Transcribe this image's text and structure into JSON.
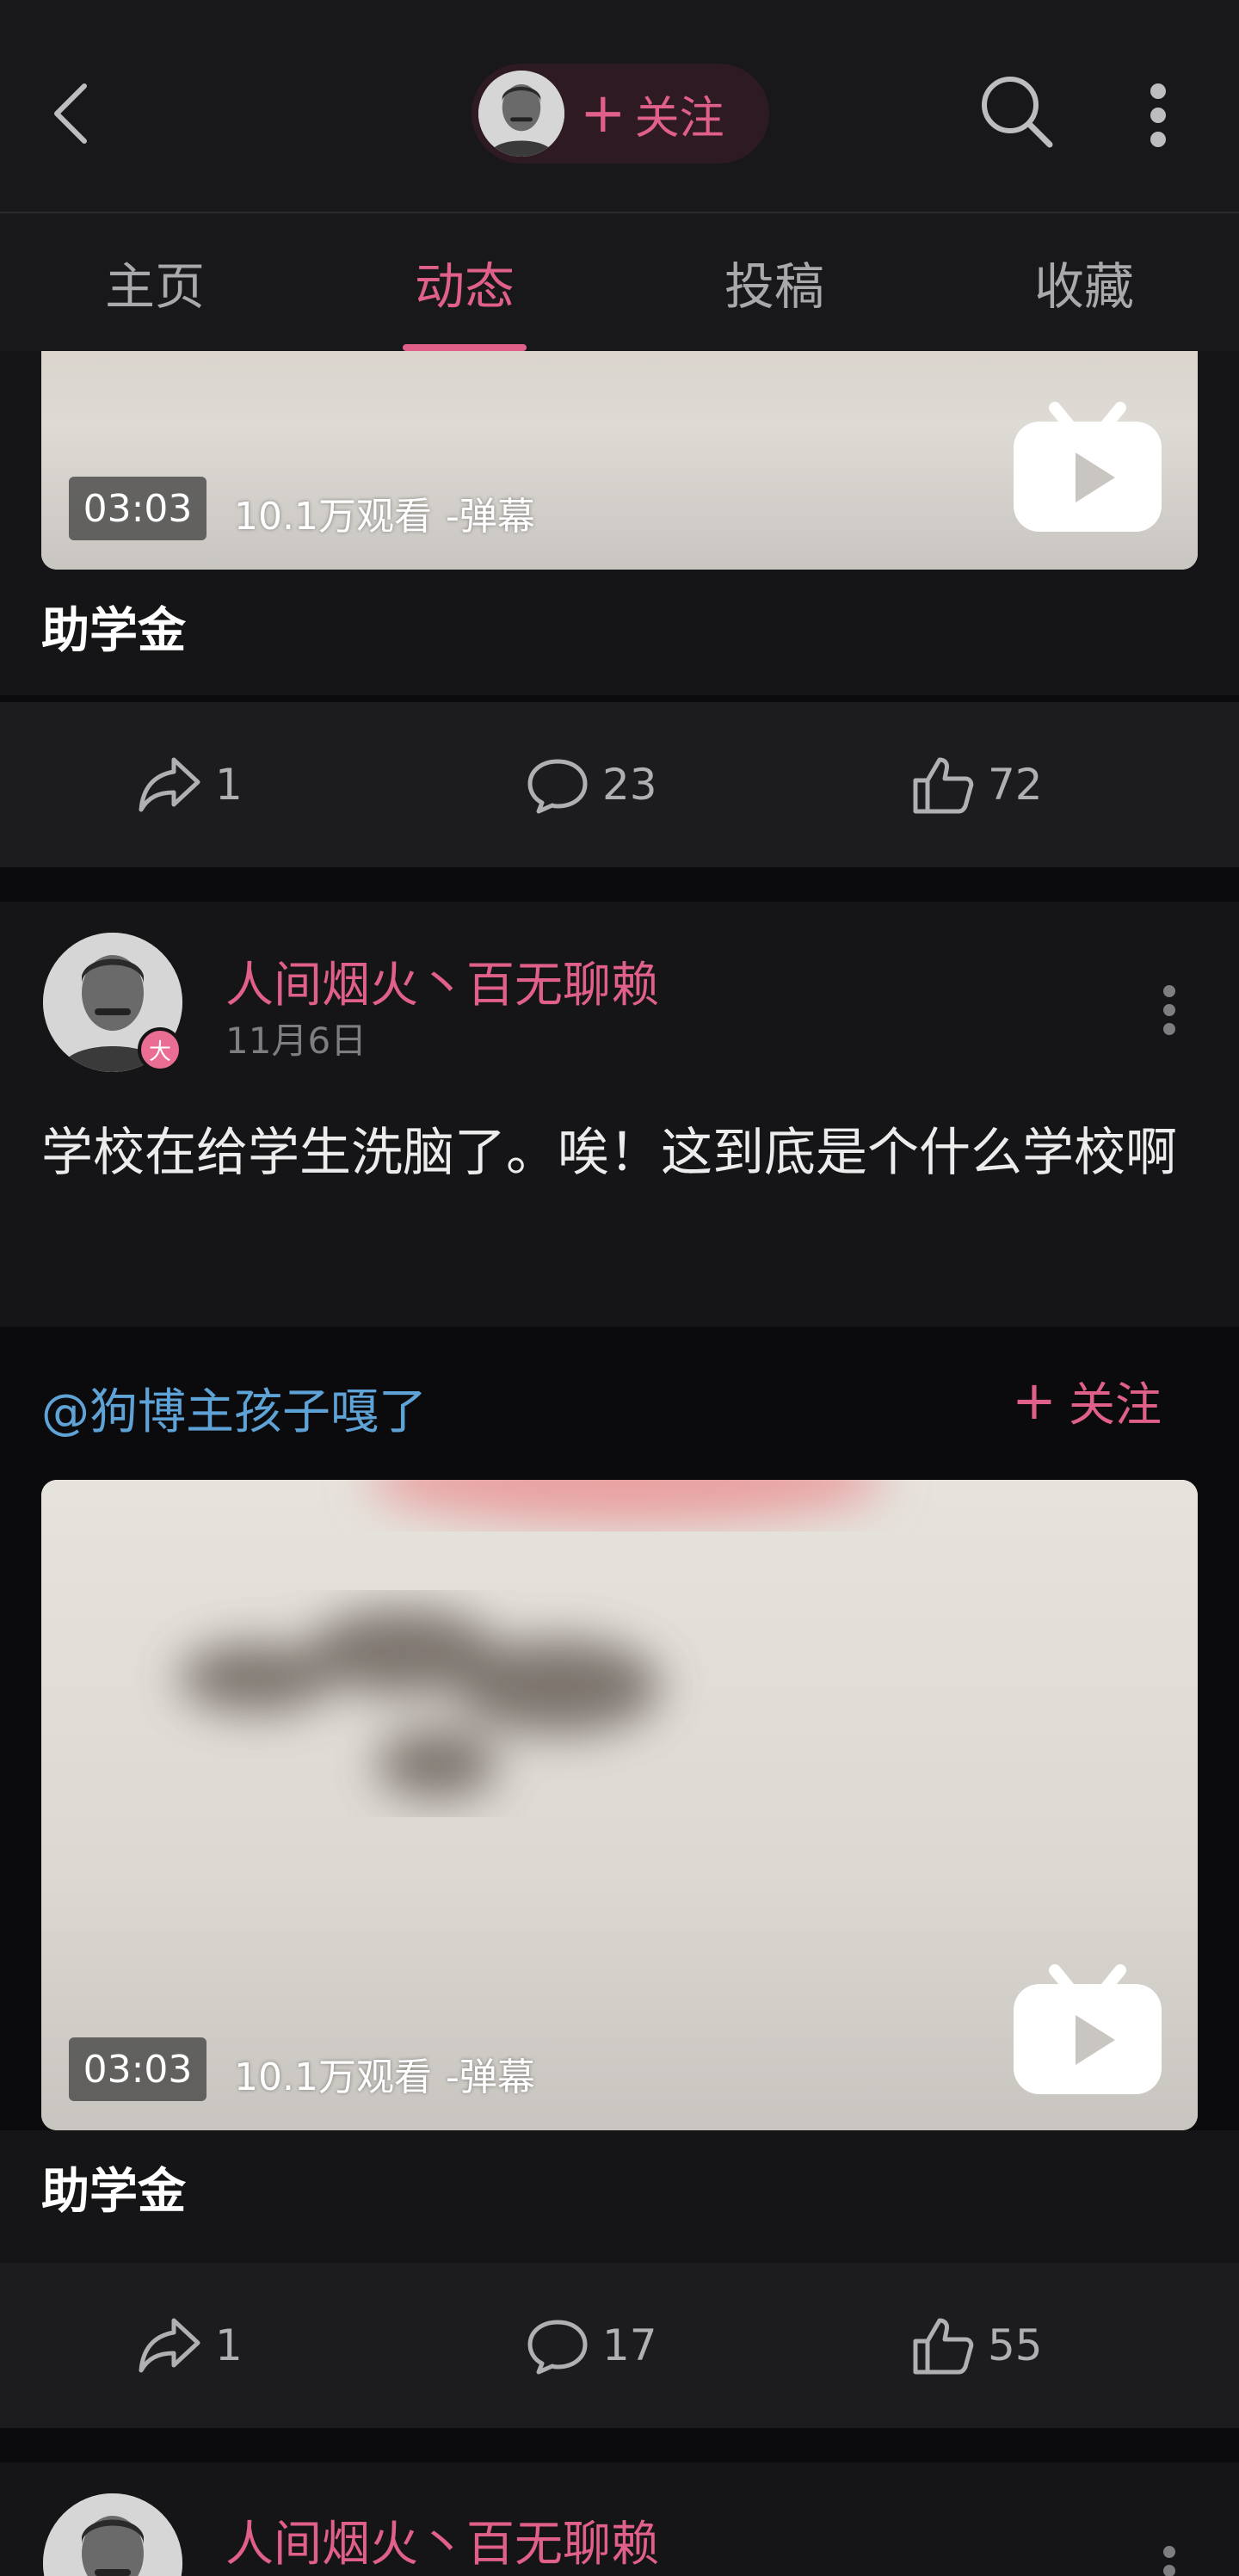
{
  "header": {
    "follow_label": "关注",
    "plus": "+"
  },
  "tabs": [
    {
      "label": "主页"
    },
    {
      "label": "动态"
    },
    {
      "label": "投稿"
    },
    {
      "label": "收藏"
    }
  ],
  "colors": {
    "accent": "#e0608a",
    "link": "#5ea2d6",
    "background": "#0b0b0d",
    "card": "#151517"
  },
  "post1": {
    "video": {
      "duration": "03:03",
      "views": "10.1万观看",
      "danmu": "-弹幕",
      "title": "助学金"
    },
    "actions": {
      "share": "1",
      "comment": "23",
      "like": "72"
    }
  },
  "post2": {
    "author": "人间烟火丶百无聊赖",
    "date": "11月6日",
    "badge": "大",
    "text": "学校在给学生洗脑了。唉！这到底是个什么学校啊",
    "repost": {
      "user": "@狗博主孩子嘎了",
      "follow_label": "关注",
      "plus": "+"
    },
    "video": {
      "duration": "03:03",
      "views": "10.1万观看",
      "danmu": "-弹幕",
      "title": "助学金"
    },
    "actions": {
      "share": "1",
      "comment": "17",
      "like": "55"
    }
  },
  "post3": {
    "author": "人间烟火丶百无聊赖"
  }
}
